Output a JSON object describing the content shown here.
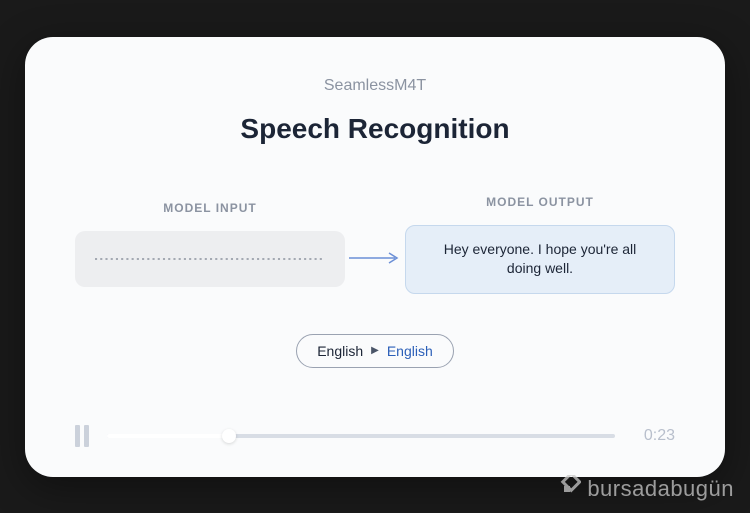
{
  "header": {
    "subtitle": "SeamlessM4T",
    "title": "Speech Recognition"
  },
  "labels": {
    "input": "MODEL INPUT",
    "output": "MODEL OUTPUT"
  },
  "output_text": "Hey everyone. I hope you're all doing well.",
  "language": {
    "source": "English",
    "target": "English"
  },
  "player": {
    "time": "0:23",
    "progress_percent": 24
  },
  "watermark": "bursadabugün"
}
